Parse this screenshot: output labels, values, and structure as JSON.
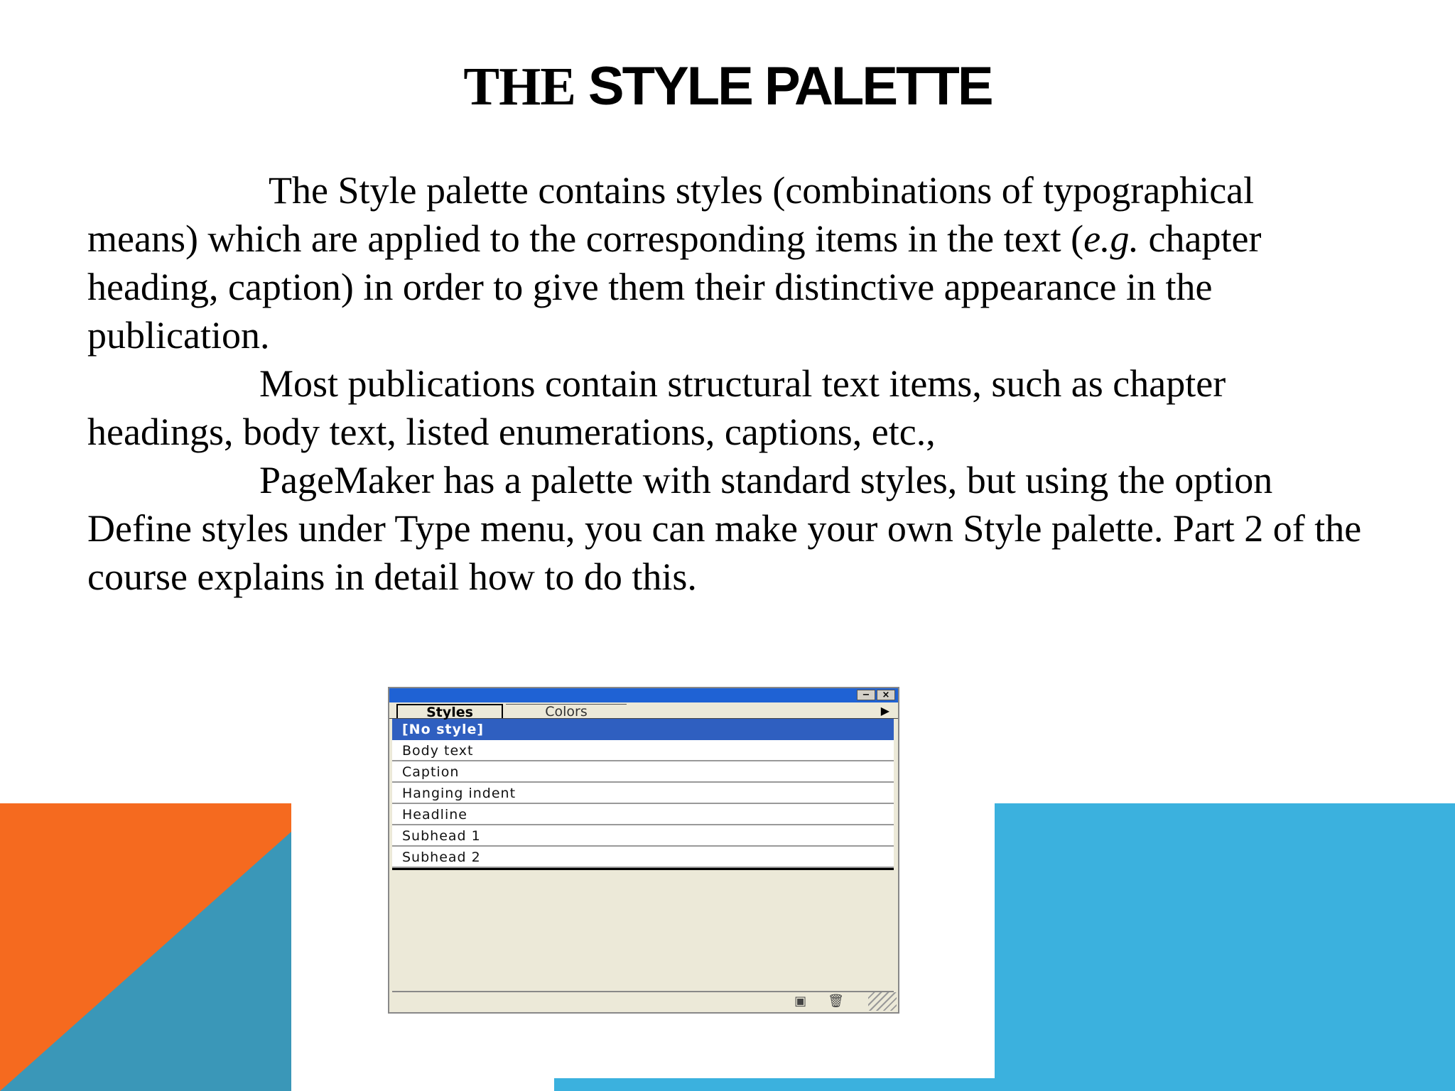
{
  "slide": {
    "title_part1": "THE ",
    "title_part2": "STYLE PALETTE",
    "paragraph1_a": "The Style palette contains styles (combinations of typographical means) which are applied to the corresponding items in the text (",
    "paragraph1_em": "e.g.",
    "paragraph1_b": " chapter heading, caption) in order to give them their distinctive appearance in the publication.",
    "paragraph2": "Most publications contain structural text items, such as chapter headings, body text, listed enumerations, captions, etc.,",
    "paragraph3": "PageMaker has a palette with standard styles, but using the option Define styles under Type menu, you can make your own Style palette. Part 2 of the course explains in detail how to do this."
  },
  "palette": {
    "minimize_glyph": "−",
    "close_glyph": "×",
    "tabs": {
      "styles": "Styles",
      "colors": "Colors"
    },
    "menu_arrow": "▶",
    "items": [
      {
        "label": "[No style]"
      },
      {
        "label": "Body text"
      },
      {
        "label": "Caption"
      },
      {
        "label": "Hanging indent"
      },
      {
        "label": "Headline"
      },
      {
        "label": "Subhead 1"
      },
      {
        "label": "Subhead 2"
      }
    ],
    "new_style_icon": "▣",
    "delete_icon": "🗑"
  },
  "colors": {
    "orange": "#f56a1f",
    "teal": "#3a97b8",
    "blue": "#3bb1de",
    "titlebar": "#1f62d4",
    "selection": "#2f5fc0"
  }
}
